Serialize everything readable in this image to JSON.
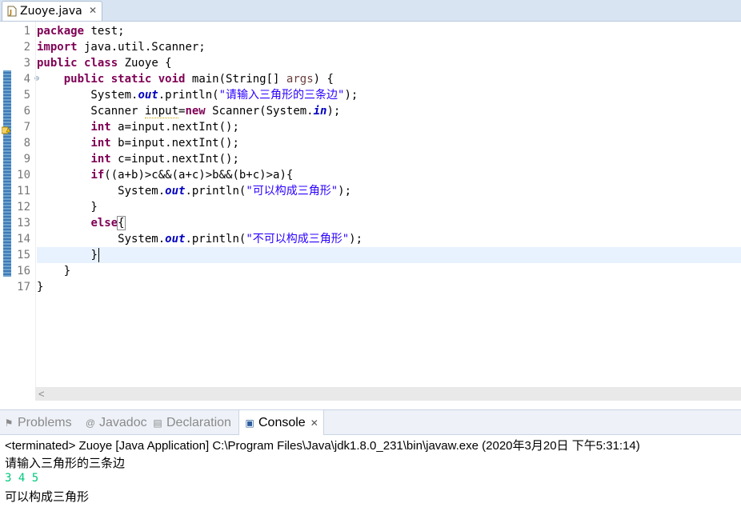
{
  "editor_tab": {
    "title": "Zuoye.java",
    "close": "✕"
  },
  "line_numbers": [
    "1",
    "2",
    "3",
    "4",
    "5",
    "6",
    "7",
    "8",
    "9",
    "10",
    "11",
    "12",
    "13",
    "14",
    "15",
    "16",
    "17"
  ],
  "code": {
    "l1": {
      "kw": "package",
      "rest": " test;"
    },
    "l2": {
      "kw": "import",
      "rest": " java.util.Scanner;"
    },
    "l3": {
      "kw1": "public",
      "kw2": "class",
      "rest": " Zuoye {"
    },
    "l4": {
      "indent": "    ",
      "kw1": "public",
      "kw2": "static",
      "kw3": "void",
      "pre": " main(String[] ",
      "arg": "args",
      "post": ") {"
    },
    "l5": {
      "pre": "        System.",
      "fld": "out",
      "mid": ".println(",
      "str": "\"请输入三角形的三条边\"",
      "post": ");"
    },
    "l6": {
      "pre": "        Scanner ",
      "var": "input",
      "eq": "=",
      "kw": "new",
      "mid": " Scanner(System.",
      "fld": "in",
      "post": ");"
    },
    "l7": {
      "indent": "        ",
      "kw": "int",
      "rest": " a=input.nextInt();"
    },
    "l8": {
      "indent": "        ",
      "kw": "int",
      "rest": " b=input.nextInt();"
    },
    "l9": {
      "indent": "        ",
      "kw": "int",
      "rest": " c=input.nextInt();"
    },
    "l10": {
      "indent": "        ",
      "kw": "if",
      "rest": "((a+b)>c&&(a+c)>b&&(b+c)>a){"
    },
    "l11": {
      "pre": "            System.",
      "fld": "out",
      "mid": ".println(",
      "str": "\"可以构成三角形\"",
      "post": ");"
    },
    "l12": {
      "text": "        }"
    },
    "l13": {
      "indent": "        ",
      "kw": "else",
      "brace": "{"
    },
    "l14": {
      "pre": "            System.",
      "fld": "out",
      "mid": ".println(",
      "str": "\"不可以构成三角形\"",
      "post": ");"
    },
    "l15": {
      "indent": "        ",
      "brace": "}"
    },
    "l16": {
      "text": "    }"
    },
    "l17": {
      "text": "}"
    }
  },
  "views": {
    "problems": "Problems",
    "javadoc": "Javadoc",
    "declaration": "Declaration",
    "console": "Console",
    "close": "✕"
  },
  "console": {
    "status": "<terminated> Zuoye [Java Application] C:\\Program Files\\Java\\jdk1.8.0_231\\bin\\javaw.exe (2020年3月20日 下午5:31:14)",
    "out1": "请输入三角形的三条边",
    "input": "3 4 5",
    "out2": "可以构成三角形"
  },
  "colors": {
    "keyword": "#7f0055",
    "string": "#2a00ff",
    "field": "#0000c0",
    "console_input": "#00c87d",
    "current_line": "#e8f2fe"
  }
}
